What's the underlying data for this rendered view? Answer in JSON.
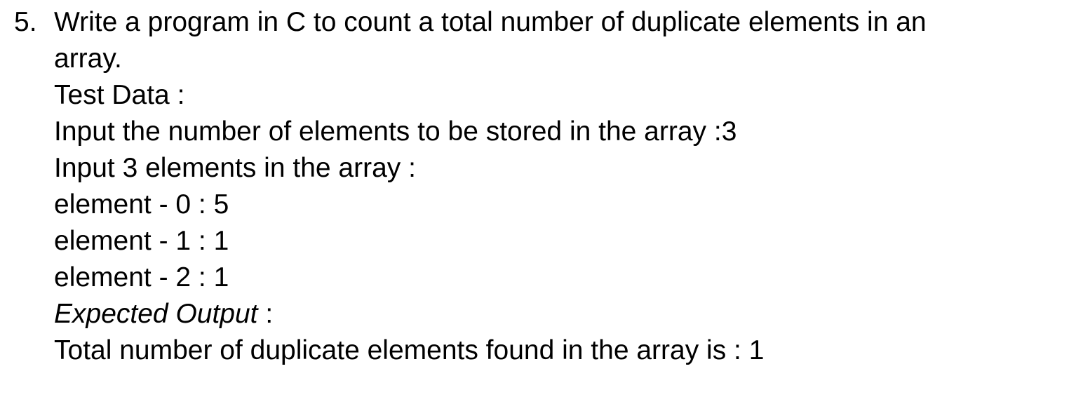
{
  "exercise": {
    "number": "5.",
    "question": [
      "Write a program in C to count a total number of duplicate elements in an",
      "array."
    ],
    "test_data_label": "Test Data :",
    "test_data": [
      "Input the number of elements to be stored in the array :3",
      "Input 3 elements in the array :",
      "element - 0 : 5",
      "element - 1 : 1",
      "element - 2 : 1"
    ],
    "expected_output_label": "Expected Output",
    "expected_output_colon": " :",
    "expected_output": "Total number of duplicate elements found in the array is : 1"
  }
}
